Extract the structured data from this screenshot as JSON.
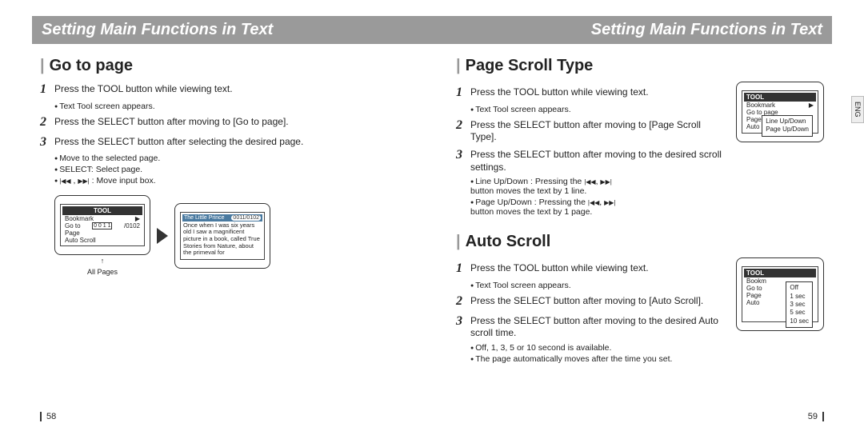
{
  "header_left": "Setting Main Functions in Text",
  "header_right": "Setting Main Functions in Text",
  "side_tab": "ENG",
  "page_num_left": "58",
  "page_num_right": "59",
  "go_to_page": {
    "title": "Go to page",
    "step1": "Press the TOOL button while viewing text.",
    "step1_sub": "Text Tool screen appears.",
    "step2": "Press the SELECT button after moving to [Go to page].",
    "step3": "Press the SELECT button after selecting the desired page.",
    "step3_sub1": "Move to the selected page.",
    "step3_sub2": "SELECT: Select page.",
    "step3_sub3_prefix": " , ",
    "step3_sub3_suffix": " : Move input box.",
    "all_pages": "All Pages",
    "device_tool": "TOOL",
    "device_items": {
      "a": "Bookmark",
      "b": "Go to",
      "c": "Page",
      "d": "Auto Scroll"
    },
    "device_digits": "0 0 1 1",
    "device_total": "/0102",
    "book_title": "The Little Prince",
    "book_page": "0011/0102",
    "book_body": "Once when I was six years old I saw a magnificent picture in a book, called True Stories from Nature, about the primeval for"
  },
  "page_scroll": {
    "title": "Page Scroll Type",
    "step1": "Press the TOOL button while viewing text.",
    "step1_sub": "Text Tool screen appears.",
    "step2": "Press the SELECT button after moving to [Page Scroll Type].",
    "step3": "Press the SELECT button after moving to the desired scroll settings.",
    "step3_sub1_prefix": "Line Up/Down : Pressing the ",
    "step3_sub1_suffix": " button moves the text by 1 line.",
    "step3_sub2_prefix": "Page Up/Down : Pressing the ",
    "step3_sub2_suffix": " button moves the text by 1 page.",
    "menu": {
      "tool": "TOOL",
      "a": "Bookmark",
      "b": "Go to page",
      "c": "Page",
      "d": "Auto"
    },
    "submenu": {
      "a": "Line Up/Down",
      "b": "Page Up/Down"
    }
  },
  "auto_scroll": {
    "title": "Auto Scroll",
    "step1": "Press the TOOL button while viewing text.",
    "step1_sub": "Text Tool screen appears.",
    "step2": "Press the SELECT button after moving to [Auto Scroll].",
    "step3": "Press the SELECT button after moving to the desired Auto scroll time.",
    "step3_sub1": "Off, 1, 3, 5 or 10 second is available.",
    "step3_sub2": "The page automatically moves after the time you set.",
    "menu": {
      "tool": "TOOL",
      "a": "Bookm",
      "b": "Go to",
      "c": "Page",
      "d": "Auto"
    },
    "submenu": {
      "a": "Off",
      "b": "1 sec",
      "c": "3 sec",
      "d": "5 sec",
      "e": "10 sec"
    }
  }
}
